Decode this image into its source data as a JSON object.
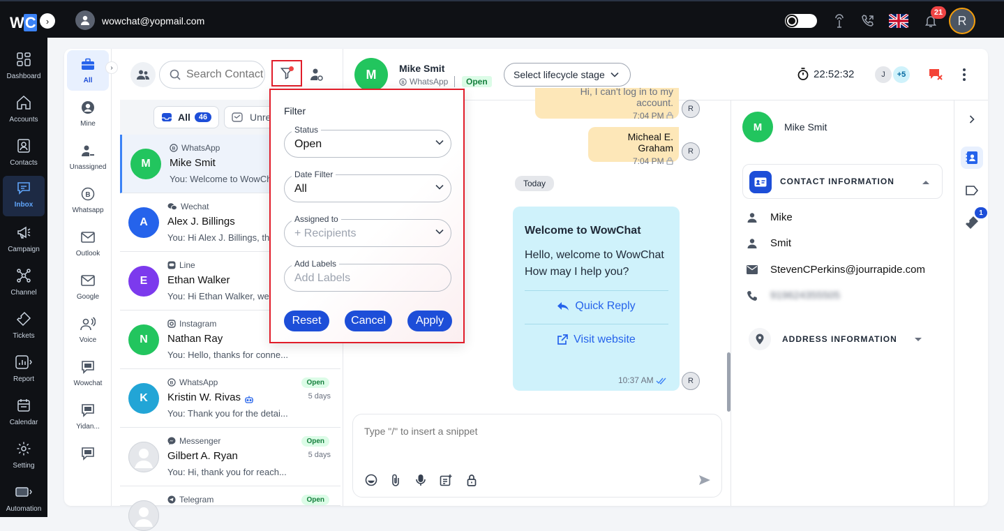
{
  "topbar": {
    "logo_prefix": "W",
    "logo_suffix": "C",
    "user_email": "wowchat@yopmail.com",
    "notification_count": "21",
    "avatar_initial": "R"
  },
  "nav": [
    {
      "label": "Dashboard",
      "icon": "dashboard-icon"
    },
    {
      "label": "Accounts",
      "icon": "home-icon"
    },
    {
      "label": "Contacts",
      "icon": "contacts-icon"
    },
    {
      "label": "Inbox",
      "icon": "inbox-icon",
      "active": true
    },
    {
      "label": "Campaign",
      "icon": "megaphone-icon"
    },
    {
      "label": "Channel",
      "icon": "channel-icon"
    },
    {
      "label": "Tickets",
      "icon": "ticket-icon"
    },
    {
      "label": "Report",
      "icon": "report-icon"
    },
    {
      "label": "Calendar",
      "icon": "calendar-icon"
    },
    {
      "label": "Setting",
      "icon": "gear-icon"
    },
    {
      "label": "Automation",
      "icon": "automation-icon"
    }
  ],
  "categories": [
    {
      "label": "All",
      "icon": "briefcase-icon",
      "active": true
    },
    {
      "label": "Mine",
      "icon": "user-circle-icon"
    },
    {
      "label": "Unassigned",
      "icon": "user-minus-icon"
    },
    {
      "label": "Whatsapp",
      "icon": "whatsapp-icon"
    },
    {
      "label": "Outlook",
      "icon": "mail-icon"
    },
    {
      "label": "Google",
      "icon": "mail-icon"
    },
    {
      "label": "Voice",
      "icon": "voice-icon"
    },
    {
      "label": "Wowchat",
      "icon": "chat-icon"
    },
    {
      "label": "Yidan...",
      "icon": "chat-icon"
    },
    {
      "label": "",
      "icon": "chat-icon"
    }
  ],
  "search": {
    "placeholder": "Search Contacts"
  },
  "tabs": {
    "all_label": "All",
    "all_count": "46",
    "unread_label": "Unre"
  },
  "conversations": [
    {
      "initial": "M",
      "color": "#22c55e",
      "channel": "WhatsApp",
      "name": "Mike Smit",
      "preview": "You: Welcome to WowChat",
      "badge": "",
      "time": "",
      "selected": true
    },
    {
      "initial": "A",
      "color": "#2563eb",
      "channel": "Wechat",
      "name": "Alex J. Billings",
      "preview": "You: Hi Alex J. Billings, thanks",
      "badge": "",
      "time": ""
    },
    {
      "initial": "E",
      "color": "#7c3aed",
      "channel": "Line",
      "name": "Ethan Walker",
      "preview": "You: Hi Ethan Walker, welcome",
      "badge": "",
      "time": ""
    },
    {
      "initial": "N",
      "color": "#22c55e",
      "channel": "Instagram",
      "name": "Nathan Ray",
      "preview": "You: Hello, thanks for conne...",
      "badge": "",
      "time": ""
    },
    {
      "initial": "K",
      "color": "#22a5d6",
      "channel": "WhatsApp",
      "name": "Kristin W. Rivas",
      "preview": "You: Thank you for the detai...",
      "badge": "Open",
      "time": "5 days"
    },
    {
      "initial": "",
      "color": "#d1d5db",
      "channel": "Messenger",
      "name": "Gilbert A. Ryan",
      "preview": "You: Hi, thank you for reach...",
      "badge": "Open",
      "time": "5 days"
    },
    {
      "initial": "",
      "color": "#d1d5db",
      "channel": "Telegram",
      "name": "",
      "preview": "",
      "badge": "Open",
      "time": ""
    }
  ],
  "filter": {
    "title": "Filter",
    "status_label": "Status",
    "status_value": "Open",
    "date_label": "Date Filter",
    "date_value": "All",
    "assigned_label": "Assigned to",
    "assigned_placeholder": "+ Recipients",
    "labels_label": "Add Labels",
    "labels_placeholder": "Add Labels",
    "reset": "Reset",
    "cancel": "Cancel",
    "apply": "Apply"
  },
  "chat": {
    "initial": "M",
    "name": "Mike Smit",
    "channel": "WhatsApp",
    "status": "Open",
    "lifecycle": "Select lifecycle stage",
    "timer": "22:52:32",
    "agent_initial": "J",
    "agent_more": "+5",
    "messages": [
      {
        "text": "Hi, I can't log in to my account.",
        "time": "7:04 PM"
      },
      {
        "text": "Micheal E. Graham",
        "time": "7:04 PM"
      }
    ],
    "day": "Today",
    "template": {
      "title": "Welcome to WowChat",
      "body": "Hello, welcome to WowChat How may I help you?",
      "quick_reply": "Quick Reply",
      "visit": "Visit website",
      "time": "10:37 AM"
    },
    "reply_initial": "R",
    "composer_placeholder": "Type \"/\" to insert a snippet"
  },
  "contact": {
    "initial": "M",
    "name": "Mike Smit",
    "section_contact": "CONTACT INFORMATION",
    "first_name": "Mike",
    "last_name": "Smit",
    "email": "StevenCPerkins@jourrapide.com",
    "phone": "919624355505",
    "section_address": "ADDRESS INFORMATION",
    "tickets_badge": "1"
  }
}
